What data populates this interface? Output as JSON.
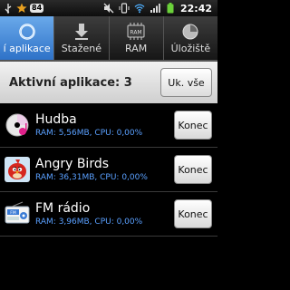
{
  "status_bar": {
    "notification_count": "84",
    "time": "22:42",
    "icons": [
      "usb-icon",
      "star-icon",
      "mute-icon",
      "vibrate-icon",
      "wifi-icon",
      "signal-icon",
      "battery-icon"
    ]
  },
  "tabs": [
    {
      "label": "í aplikace",
      "icon": "refresh-circle-icon",
      "active": true
    },
    {
      "label": "Stažené",
      "icon": "download-icon",
      "active": false
    },
    {
      "label": "RAM",
      "icon": "ram-chip-icon",
      "active": false
    },
    {
      "label": "Úložiště",
      "icon": "storage-pie-icon",
      "active": false
    }
  ],
  "header": {
    "title": "Aktivní aplikace: 3",
    "kill_all_label": "Uk. vše"
  },
  "apps": [
    {
      "name": "Hudba",
      "stats": "RAM: 5,56MB, CPU: 0,00%",
      "end_label": "Konec",
      "icon": "music-cd-icon"
    },
    {
      "name": "Angry Birds",
      "stats": "RAM: 36,31MB, CPU: 0,00%",
      "end_label": "Konec",
      "icon": "angry-bird-icon"
    },
    {
      "name": "FM rádio",
      "stats": "RAM: 3,96MB, CPU: 0,00%",
      "end_label": "Konec",
      "icon": "radio-icon"
    }
  ],
  "colors": {
    "accent": "#2e72c8",
    "stats_text": "#5aa0ff",
    "battery": "#6bd13a"
  }
}
